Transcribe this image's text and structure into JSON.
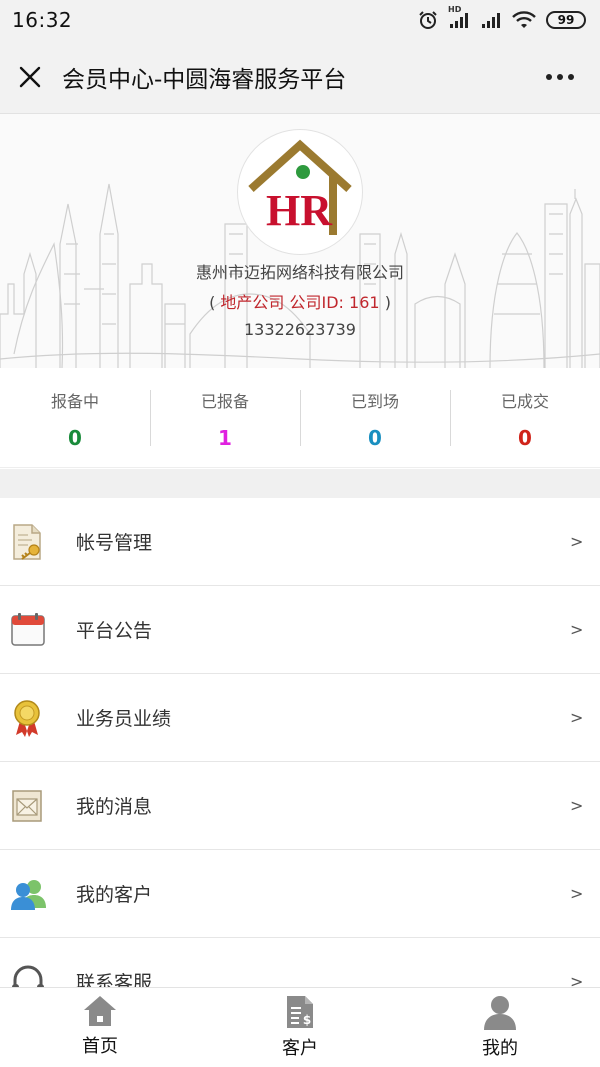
{
  "status_bar": {
    "time": "16:32",
    "network_label": "HD",
    "battery": "99",
    "icons": [
      "alarm-icon",
      "signal-hd-icon",
      "signal-icon",
      "wifi-icon",
      "battery-icon"
    ]
  },
  "header": {
    "title": "会员中心-中圆海睿服务平台",
    "close_icon": "close-icon",
    "more_icon": "more-icon"
  },
  "profile": {
    "logo_text": "HR",
    "company_name": "惠州市迈拓网络科技有限公司",
    "open_paren": "(",
    "company_type": "地产公司",
    "id_label": "公司ID:",
    "company_id": "161",
    "close_paren": ")",
    "phone": "13322623739"
  },
  "stats": [
    {
      "label": "报备中",
      "value": "0",
      "color": "#1a8b3b"
    },
    {
      "label": "已报备",
      "value": "1",
      "color": "#e020e0"
    },
    {
      "label": "已到场",
      "value": "0",
      "color": "#1a8fc0"
    },
    {
      "label": "已成交",
      "value": "0",
      "color": "#d0241a"
    }
  ],
  "menu": [
    {
      "label": "帐号管理",
      "icon": "account-key-icon",
      "arrow": ">"
    },
    {
      "label": "平台公告",
      "icon": "calendar-icon",
      "arrow": ">"
    },
    {
      "label": "业务员业绩",
      "icon": "medal-icon",
      "arrow": ">"
    },
    {
      "label": "我的消息",
      "icon": "envelope-icon",
      "arrow": ">"
    },
    {
      "label": "我的客户",
      "icon": "users-icon",
      "arrow": ">"
    },
    {
      "label": "联系客服",
      "icon": "headset-icon",
      "arrow": ">"
    }
  ],
  "bottom_nav": [
    {
      "label": "首页",
      "icon": "home-icon"
    },
    {
      "label": "客户",
      "icon": "document-icon"
    },
    {
      "label": "我的",
      "icon": "user-icon"
    }
  ]
}
